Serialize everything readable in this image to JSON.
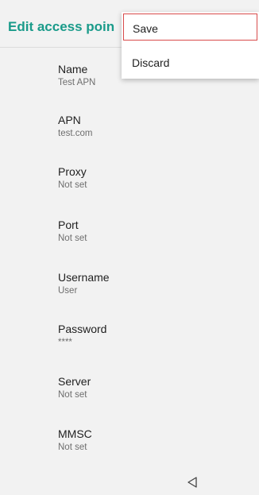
{
  "app_bar": {
    "title": "Edit access poin"
  },
  "menu": {
    "items": [
      {
        "label": "Save"
      },
      {
        "label": "Discard"
      }
    ]
  },
  "preferences": [
    {
      "title": "Name",
      "summary": "Test APN"
    },
    {
      "title": "APN",
      "summary": "test.com"
    },
    {
      "title": "Proxy",
      "summary": "Not set"
    },
    {
      "title": "Port",
      "summary": "Not set"
    },
    {
      "title": "Username",
      "summary": "User"
    },
    {
      "title": "Password",
      "summary": "****"
    },
    {
      "title": "Server",
      "summary": "Not set"
    },
    {
      "title": "MMSC",
      "summary": "Not set"
    }
  ],
  "nav": {
    "back_icon": "back-triangle-icon"
  },
  "colors": {
    "accent": "#1a9b8a",
    "background": "#f2f2f2",
    "menu_highlight": "#d84b4b"
  }
}
